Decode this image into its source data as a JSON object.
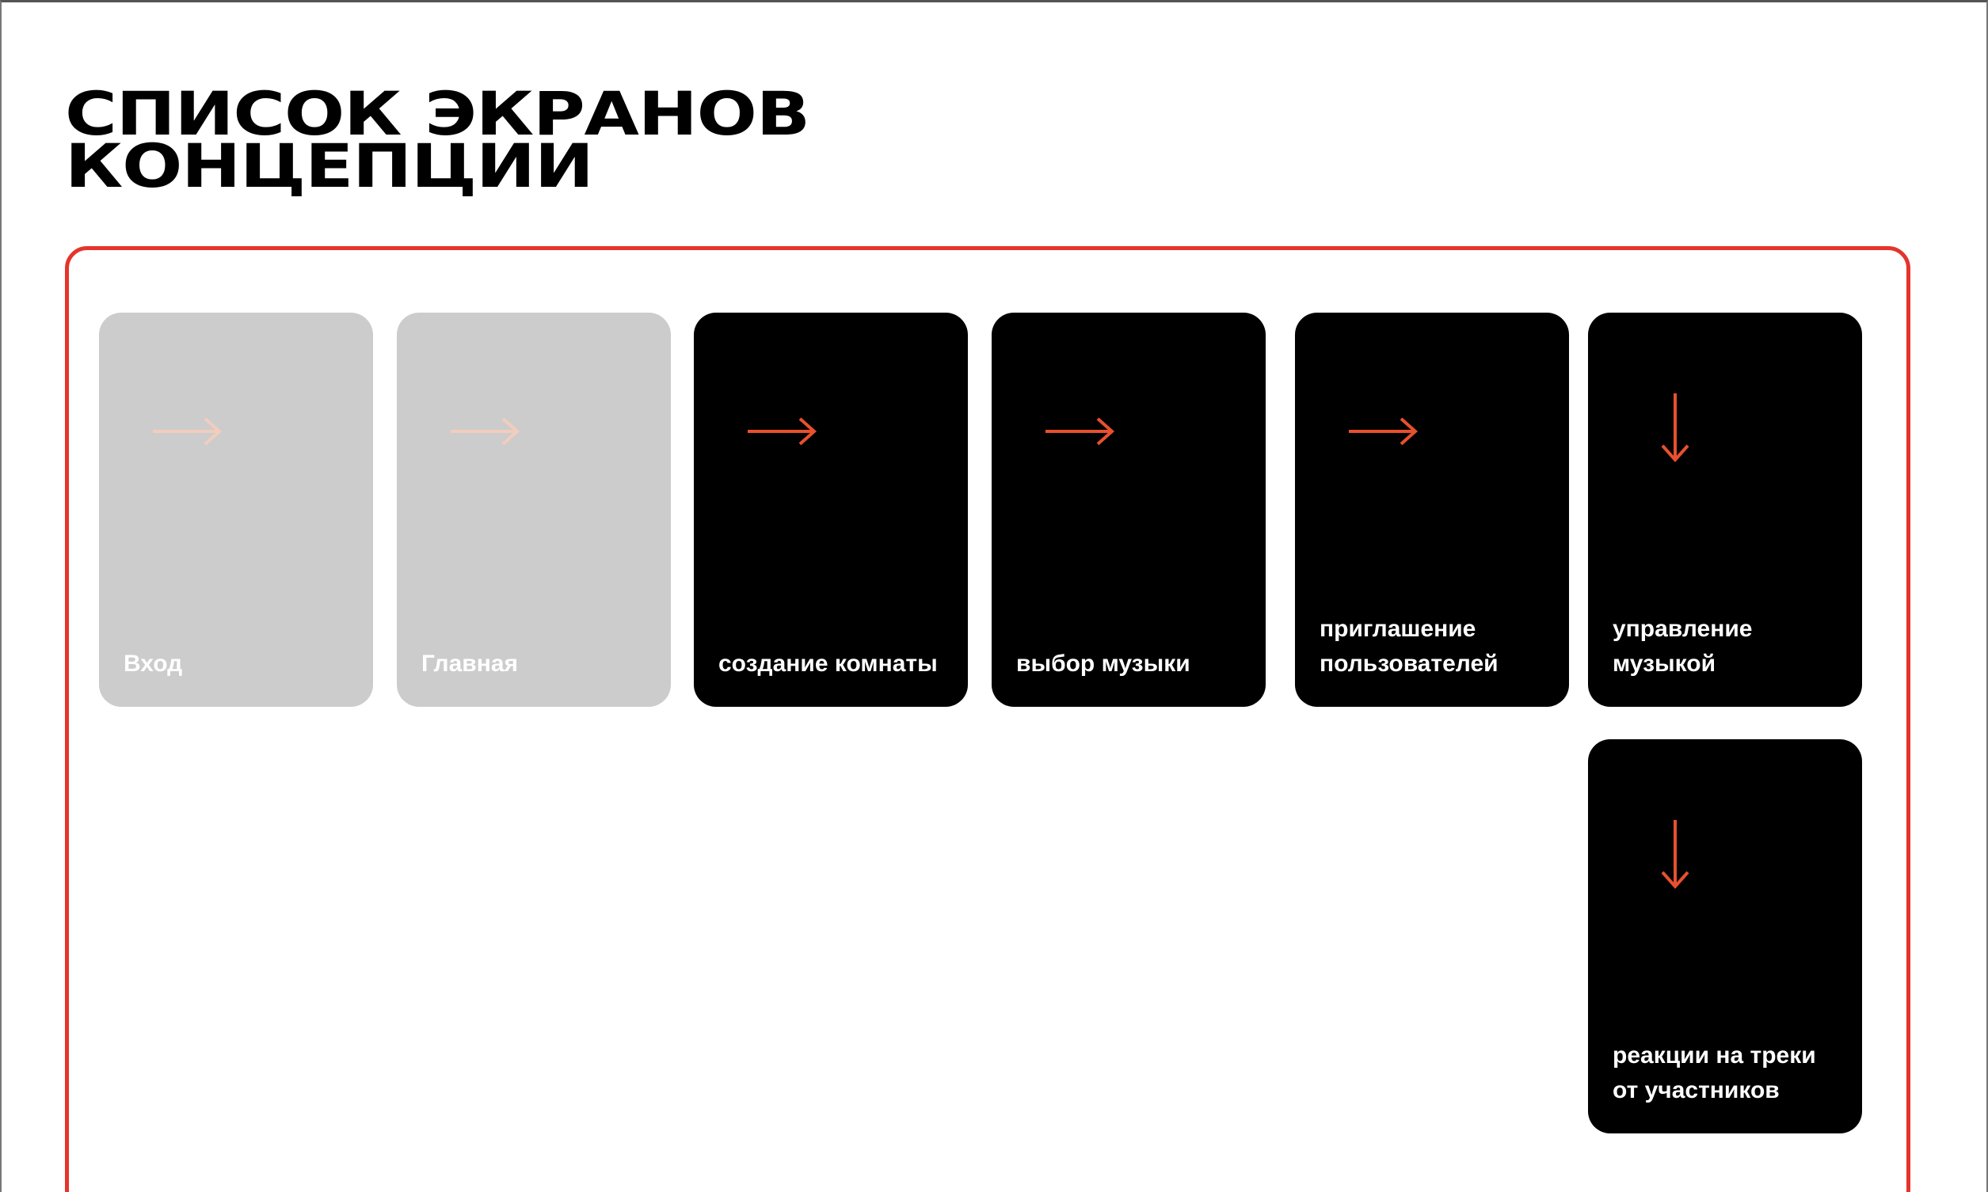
{
  "title": {
    "line1": "СПИСОК ЭКРАНОВ",
    "line2": "КОНЦЕПЦИИ"
  },
  "colors": {
    "accent": "#e5342b",
    "arrow_active": "#e8502f",
    "arrow_dim": "#f2cdbd",
    "card_dim": "#cccccc",
    "card_active": "#000000"
  },
  "screens": [
    {
      "label": "Вход",
      "state": "dim",
      "arrow": "arrow-right-icon"
    },
    {
      "label": "Главная",
      "state": "dim",
      "arrow": "arrow-right-icon"
    },
    {
      "label": "создание комнаты",
      "state": "active",
      "arrow": "arrow-right-icon"
    },
    {
      "label": "выбор музыки",
      "state": "active",
      "arrow": "arrow-right-icon"
    },
    {
      "label": "приглашение\nпользователей",
      "state": "active",
      "arrow": "arrow-right-icon"
    },
    {
      "label": "управление\nмузыкой",
      "state": "active",
      "arrow": "arrow-down-icon"
    },
    {
      "label": "реакции  на треки\nот участников",
      "state": "active",
      "arrow": "arrow-down-icon"
    }
  ]
}
